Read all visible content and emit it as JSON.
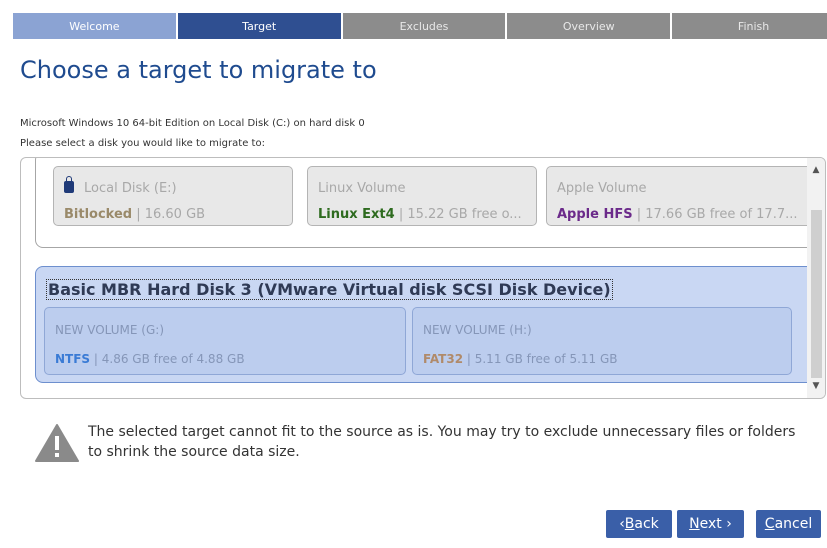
{
  "steps": [
    "Welcome",
    "Target",
    "Excludes",
    "Overview",
    "Finish"
  ],
  "title": "Choose a target to migrate to",
  "info": {
    "source_line": "Microsoft Windows 10 64-bit Edition on Local Disk (C:) on hard disk 0",
    "prompt_line": "Please select a disk you would like to migrate to:"
  },
  "disk1": {
    "volumes": [
      {
        "name": "Local Disk (E:)",
        "fs_type": "Bitlocked",
        "fs_detail": " | 16.60 GB",
        "fs_color": "#9a8a6a",
        "locked": true
      },
      {
        "name": "Linux Volume",
        "fs_type": "Linux Ext4",
        "fs_detail": " | 15.22 GB free o...",
        "fs_color": "#2e6b1f"
      },
      {
        "name": "Apple Volume",
        "fs_type": "Apple HFS",
        "fs_detail": " | 17.66 GB free of 17.7...",
        "fs_color": "#6b2a8a"
      }
    ]
  },
  "disk3": {
    "title": "Basic MBR Hard Disk 3 (VMware Virtual disk SCSI Disk Device)",
    "volumes": [
      {
        "name": "NEW VOLUME (G:)",
        "fs_type": "NTFS",
        "fs_detail": " | 4.86 GB free of 4.88 GB",
        "fs_color": "#3a7bd5"
      },
      {
        "name": "NEW VOLUME (H:)",
        "fs_type": "FAT32",
        "fs_detail": " | 5.11 GB free of 5.11 GB",
        "fs_color": "#b08a6a"
      }
    ]
  },
  "warning": "The selected target cannot fit to the source as is. You may try to exclude unnecessary files or folders to shrink the source data size.",
  "buttons": {
    "back_prefix": "‹ ",
    "back_key": "B",
    "back_rest": "ack",
    "next_key": "N",
    "next_rest": "ext ›",
    "cancel_key": "C",
    "cancel_rest": "ancel"
  },
  "icons": {
    "lock": "lock-icon",
    "warning": "warning-icon",
    "scroll_up": "chevron-up-icon",
    "scroll_down": "chevron-down-icon"
  }
}
